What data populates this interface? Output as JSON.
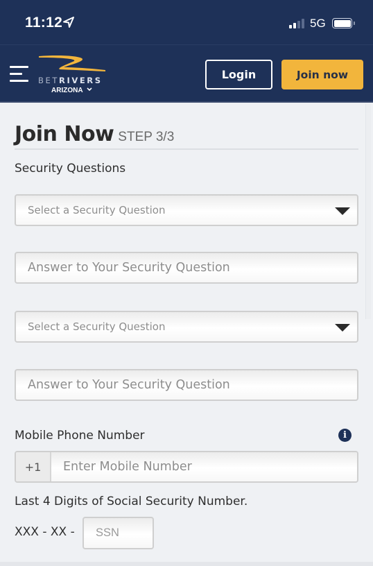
{
  "status_bar": {
    "time": "11:12",
    "location_icon": "location-arrow-icon",
    "network": "5G",
    "signal_bars_active": 2,
    "signal_bars_total": 4,
    "battery_level": 1.0
  },
  "header": {
    "menu_icon": "hamburger-menu-icon",
    "brand": {
      "bet": "BET",
      "rivers": "RIVERS"
    },
    "state": "ARIZONA",
    "login_label": "Login",
    "join_label": "Join now",
    "colors": {
      "navy": "#1e3158",
      "gold": "#f2b53c"
    }
  },
  "form": {
    "title": "Join Now",
    "step": "STEP 3/3",
    "security_label": "Security Questions",
    "question_1": {
      "placeholder": "Select a Security Question"
    },
    "answer_1": {
      "placeholder": "Answer to Your Security Question"
    },
    "question_2": {
      "placeholder": "Select a Security Question"
    },
    "answer_2": {
      "placeholder": "Answer to Your Security Question"
    },
    "phone_label": "Mobile Phone Number",
    "phone_info_icon": "info-icon",
    "phone_prefix": "+1",
    "phone_placeholder": "Enter Mobile Number",
    "ssn_label": "Last 4 Digits of Social Security Number.",
    "ssn_prefix": "XXX - XX -",
    "ssn_placeholder": "SSN"
  }
}
